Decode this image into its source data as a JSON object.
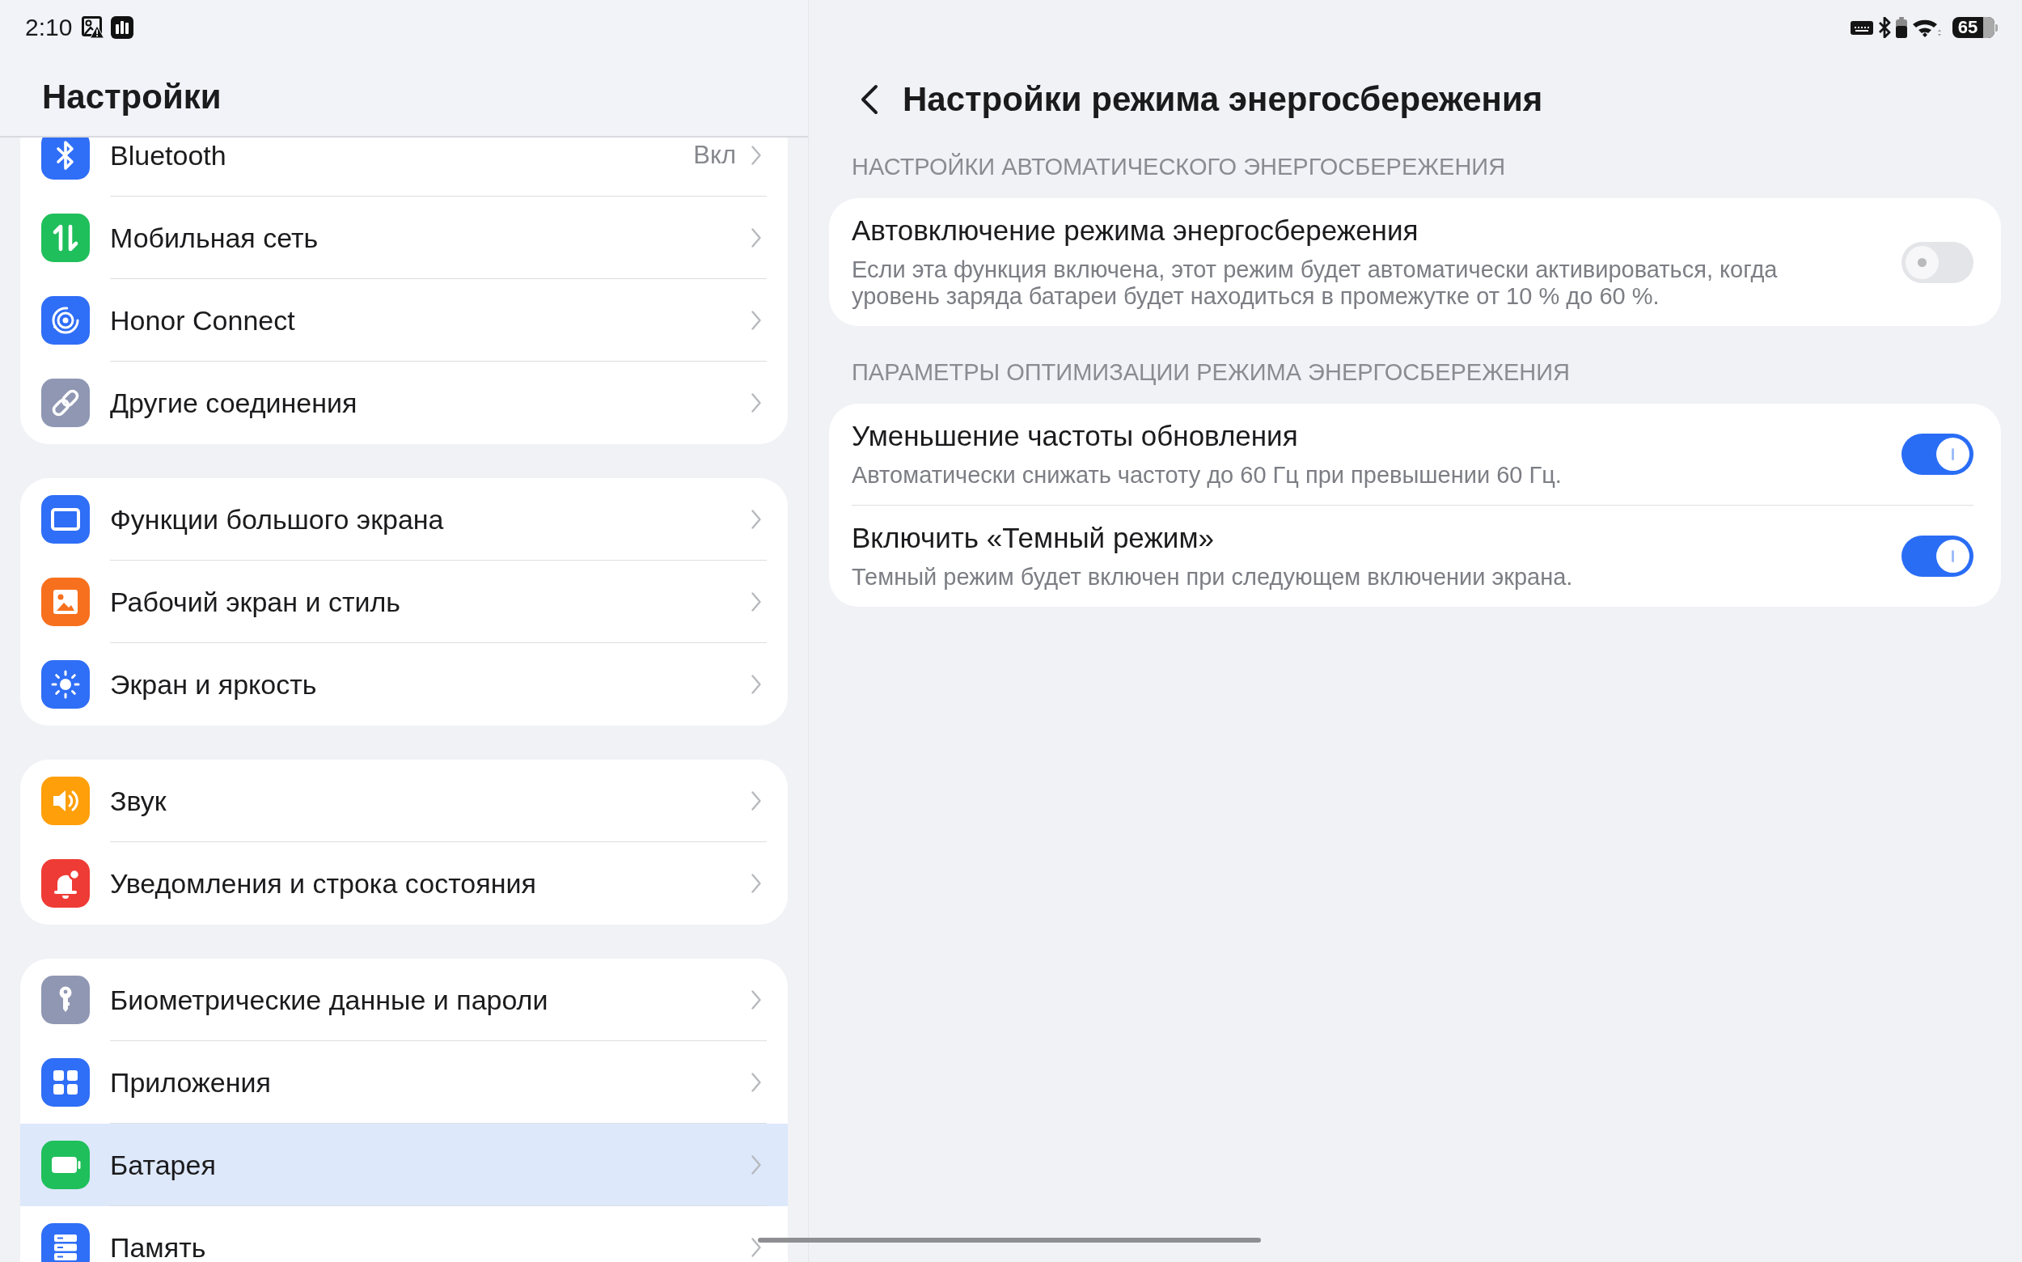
{
  "status_bar": {
    "time": "2:10",
    "battery": "65"
  },
  "sidebar": {
    "title": "Настройки",
    "groups": [
      {
        "items": [
          {
            "label": "Bluetooth",
            "value": "Вкл",
            "color": "#2f6ef6",
            "selected": false
          },
          {
            "label": "Мобильная сеть",
            "color": "#1fbf5b",
            "selected": false
          },
          {
            "label": "Honor Connect",
            "color": "#2f6ef6",
            "selected": false
          },
          {
            "label": "Другие соединения",
            "color": "#8f97b3",
            "selected": false
          }
        ]
      },
      {
        "items": [
          {
            "label": "Функции большого экрана",
            "color": "#2f6ef6",
            "selected": false
          },
          {
            "label": "Рабочий экран и стиль",
            "color": "#f7701e",
            "selected": false
          },
          {
            "label": "Экран и яркость",
            "color": "#2f6ef6",
            "selected": false
          }
        ]
      },
      {
        "items": [
          {
            "label": "Звук",
            "color": "#ff9f0a",
            "selected": false
          },
          {
            "label": "Уведомления и строка состояния",
            "color": "#ef3b35",
            "selected": false
          }
        ]
      },
      {
        "items": [
          {
            "label": "Биометрические данные и пароли",
            "color": "#8f97b3",
            "selected": false
          },
          {
            "label": "Приложения",
            "color": "#2f6ef6",
            "selected": false
          },
          {
            "label": "Батарея",
            "color": "#1fbf5b",
            "selected": true
          },
          {
            "label": "Память",
            "color": "#2f6ef6",
            "selected": false
          }
        ]
      }
    ]
  },
  "detail": {
    "title": "Настройки режима энергосбережения",
    "sections": [
      {
        "header": "НАСТРОЙКИ АВТОМАТИЧЕСКОГО ЭНЕРГОСБЕРЕЖЕНИЯ",
        "rows": [
          {
            "title": "Автовключение режима энергосбережения",
            "description": "Если эта функция включена, этот режим будет автоматически активироваться, когда уровень заряда батареи будет находиться в промежутке от 10 % до 60 %.",
            "on": false
          }
        ]
      },
      {
        "header": "ПАРАМЕТРЫ ОПТИМИЗАЦИИ РЕЖИМА ЭНЕРГОСБЕРЕЖЕНИЯ",
        "rows": [
          {
            "title": "Уменьшение частоты обновления",
            "description": "Автоматически снижать частоту до 60 Гц при превышении 60 Гц.",
            "on": true
          },
          {
            "title": "Включить «Темный режим»",
            "description": "Темный режим будет включен при следующем включении экрана.",
            "on": true
          }
        ]
      }
    ]
  }
}
